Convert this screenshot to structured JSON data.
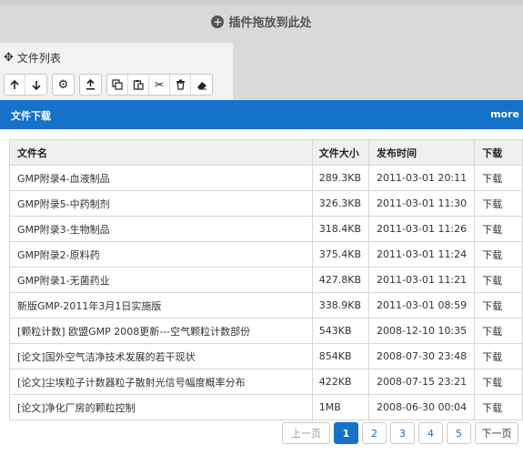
{
  "dropzone": {
    "label": "插件拖放到此处"
  },
  "panel": {
    "title": "文件列表",
    "toolbar_icons": [
      "arrow-up-icon",
      "arrow-down-icon",
      "gear-icon",
      "upload-icon",
      "copy-icon",
      "paste-icon",
      "scissors-icon",
      "trash-icon",
      "eraser-icon"
    ]
  },
  "section": {
    "title": "文件下载",
    "more": "more"
  },
  "table": {
    "headers": [
      "文件名",
      "文件大小",
      "发布时间",
      "下载"
    ],
    "rows": [
      [
        "GMP附录4-血液制品",
        "289.3KB",
        "2011-03-01 20:11",
        "下载"
      ],
      [
        "GMP附录5-中药制剂",
        "326.3KB",
        "2011-03-01 11:30",
        "下载"
      ],
      [
        "GMP附录3-生物制品",
        "318.4KB",
        "2011-03-01 11:26",
        "下载"
      ],
      [
        "GMP附录2-原料药",
        "375.4KB",
        "2011-03-01 11:24",
        "下载"
      ],
      [
        "GMP附录1-无菌药业",
        "427.8KB",
        "2011-03-01 11:21",
        "下载"
      ],
      [
        "新版GMP-2011年3月1日实施版",
        "338.9KB",
        "2011-03-01 08:59",
        "下载"
      ],
      [
        "[颗粒计数] 欧盟GMP 2008更新---空气颗粒计数部份",
        "543KB",
        "2008-12-10 10:35",
        "下载"
      ],
      [
        "[论文]国外空气洁净技术发展的若干现状",
        "854KB",
        "2008-07-30 23:48",
        "下载"
      ],
      [
        "[论文]尘埃粒子计数器粒子散射光信号幅度概率分布",
        "422KB",
        "2008-07-15 23:21",
        "下载"
      ],
      [
        "[论文]净化厂房的颗粒控制",
        "1MB",
        "2008-06-30 00:04",
        "下载"
      ]
    ]
  },
  "pagination": {
    "prev": "上一页",
    "pages": [
      "1",
      "2",
      "3",
      "4",
      "5"
    ],
    "active": "1",
    "next": "下一页"
  },
  "colors": {
    "accent": "#1473c9",
    "dropzone": "#d9d9d9"
  }
}
